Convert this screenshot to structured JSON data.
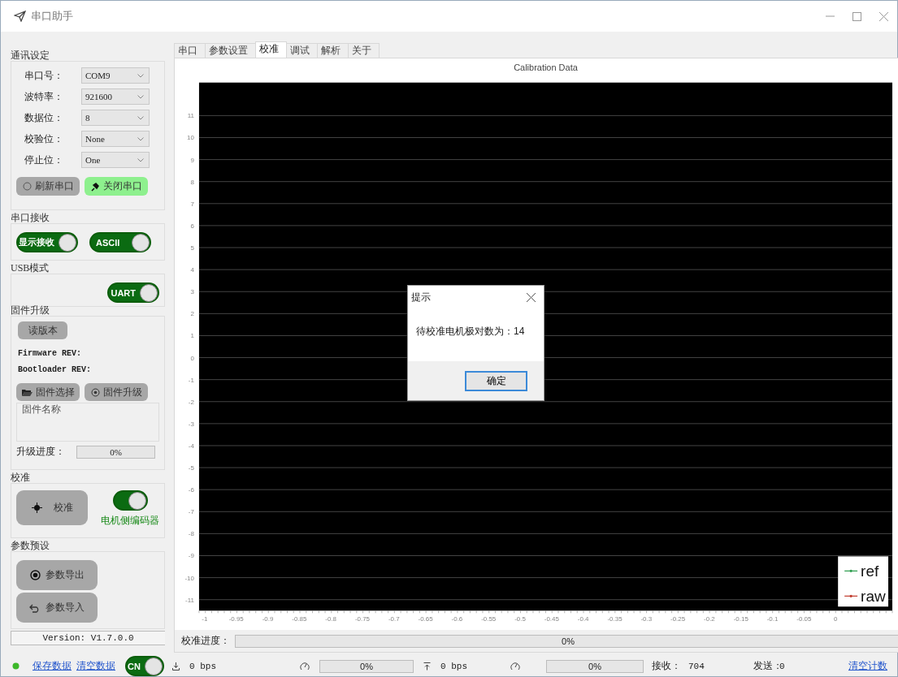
{
  "window": {
    "title": "串口助手"
  },
  "comm_settings": {
    "title": "通讯设定",
    "fields": [
      {
        "label": "串口号：",
        "value": "COM9"
      },
      {
        "label": "波特率：",
        "value": "921600"
      },
      {
        "label": "数据位：",
        "value": "8"
      },
      {
        "label": "校验位：",
        "value": "None"
      },
      {
        "label": "停止位：",
        "value": "One"
      }
    ],
    "buttons": [
      {
        "label": "刷新串口",
        "kind": "refresh"
      },
      {
        "label": "关闭串口",
        "kind": "close"
      }
    ]
  },
  "serial_receive": {
    "title": "串口接收",
    "toggles": [
      {
        "label": "显示接收",
        "on": true
      },
      {
        "label": "ASCII",
        "on": true
      }
    ]
  },
  "usb_mode": {
    "title": "USB模式",
    "toggle": {
      "label": "UART",
      "on": true
    }
  },
  "firmware": {
    "title": "固件升级",
    "read_button": "读版本",
    "firmware_rev": "Firmware REV:",
    "bootloader_rev": "Bootloader REV:",
    "buttons": [
      {
        "label": "固件选择",
        "kind": "folder"
      },
      {
        "label": "固件升级",
        "kind": "target"
      }
    ],
    "name_box": {
      "title": "固件名称"
    },
    "progress": {
      "label": "升级进度：",
      "level": 0,
      "reading": "0%"
    }
  },
  "calibration": {
    "title": "校准",
    "button": "校准",
    "toggle": {
      "label": "电机侧编码器",
      "on": true
    }
  },
  "presets": {
    "title": "参数预设",
    "buttons": [
      {
        "label": "参数导出",
        "kind": "export"
      },
      {
        "label": "参数导入",
        "kind": "import"
      }
    ]
  },
  "version": "Version: V1.7.0.0",
  "tabs": [
    {
      "label": "串口",
      "selected": false
    },
    {
      "label": "参数设置",
      "selected": false
    },
    {
      "label": "校准",
      "selected": true
    },
    {
      "label": "调试",
      "selected": false
    },
    {
      "label": "解析",
      "selected": false
    },
    {
      "label": "关于",
      "selected": false
    }
  ],
  "chart_panel": {
    "chart_data": {
      "type": "line",
      "title": "Calibration Data",
      "grid": true,
      "ylim": [
        -11.5,
        12.5
      ],
      "categories": [
        "-1",
        "-0.95",
        "-0.9",
        "-0.85",
        "-0.8",
        "-0.75",
        "-0.7",
        "-0.65",
        "-0.6",
        "-0.55",
        "-0.5",
        "-0.45",
        "-0.4",
        "-0.35",
        "-0.3",
        "-0.25",
        "-0.2",
        "-0.15",
        "-0.1",
        "-0.05",
        "0"
      ],
      "yticks": [
        11,
        10,
        9,
        8,
        7,
        6,
        5,
        4,
        3,
        2,
        1,
        0,
        -1,
        -2,
        -3,
        -4,
        -5,
        -6,
        -7,
        -8,
        -9,
        -10,
        -11
      ],
      "series": [
        {
          "name": "ref",
          "color": "#2e9e4f",
          "values": [
            null,
            null,
            null,
            null,
            null,
            null,
            null,
            null,
            null,
            null,
            null,
            null,
            null,
            null,
            null,
            null,
            null,
            null,
            null,
            null,
            null
          ]
        },
        {
          "name": "raw",
          "color": "#c0392b",
          "values": [
            null,
            null,
            null,
            null,
            null,
            null,
            null,
            null,
            null,
            null,
            null,
            null,
            null,
            null,
            null,
            null,
            null,
            null,
            null,
            null,
            null
          ]
        }
      ]
    },
    "progress": {
      "label": "校准进度：",
      "level": 0,
      "reading": "0%"
    }
  },
  "dialog": {
    "title": "提示",
    "message": "待校准电机极对数为：14",
    "button": "确定"
  },
  "status_bar": {
    "links": [
      "保存数据",
      "清空数据"
    ],
    "language_toggle": {
      "label": "CN",
      "on": true
    },
    "download": {
      "rate": "0 bps",
      "level": 0,
      "reading": "0%"
    },
    "upload": {
      "rate": "0 bps",
      "level": 0,
      "reading": "0%"
    },
    "received_label": "接收：",
    "received": "704",
    "sent_label": "发送：",
    "sent": "0",
    "clear_link": "清空计数"
  }
}
